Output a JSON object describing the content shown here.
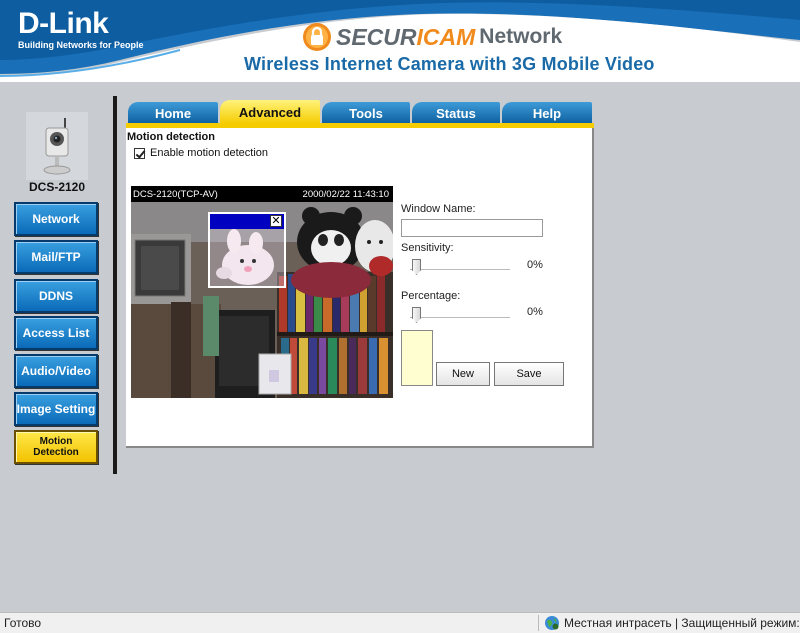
{
  "header": {
    "brand": "D-Link",
    "tagline": "Building Networks for People",
    "product_secur": "SECUR",
    "product_icam": "ICAM",
    "product_network": "Network",
    "subtitle": "Wireless Internet Camera with 3G Mobile Video"
  },
  "sidebar": {
    "model": "DCS-2120",
    "items": [
      {
        "label": "Network"
      },
      {
        "label": "Mail/FTP"
      },
      {
        "label": "DDNS"
      },
      {
        "label": "Access List"
      },
      {
        "label": "Audio/Video"
      },
      {
        "label": "Image Setting"
      },
      {
        "label": "Motion Detection",
        "active": true
      }
    ]
  },
  "tabs": [
    {
      "label": "Home"
    },
    {
      "label": "Advanced",
      "active": true
    },
    {
      "label": "Tools"
    },
    {
      "label": "Status"
    },
    {
      "label": "Help"
    }
  ],
  "motion": {
    "section_title": "Motion detection",
    "enable_label": "Enable motion detection",
    "enabled": true,
    "video_source": "DCS-2120(TCP-AV)",
    "video_timestamp": "2000/02/22 11:43:10",
    "window_close": "✕",
    "window_name_label": "Window Name:",
    "window_name_value": "",
    "sensitivity_label": "Sensitivity:",
    "sensitivity_value": "0%",
    "percentage_label": "Percentage:",
    "percentage_value": "0%",
    "new_button": "New",
    "save_button": "Save"
  },
  "statusbar": {
    "left": "Готово",
    "right": "Местная интрасеть | Защищенный режим:"
  },
  "colors": {
    "header_blue": "#1a70b8",
    "tab_blue": "#0d5f9e",
    "tab_active": "#f5cc00",
    "accent_orange": "#f08a1c"
  }
}
